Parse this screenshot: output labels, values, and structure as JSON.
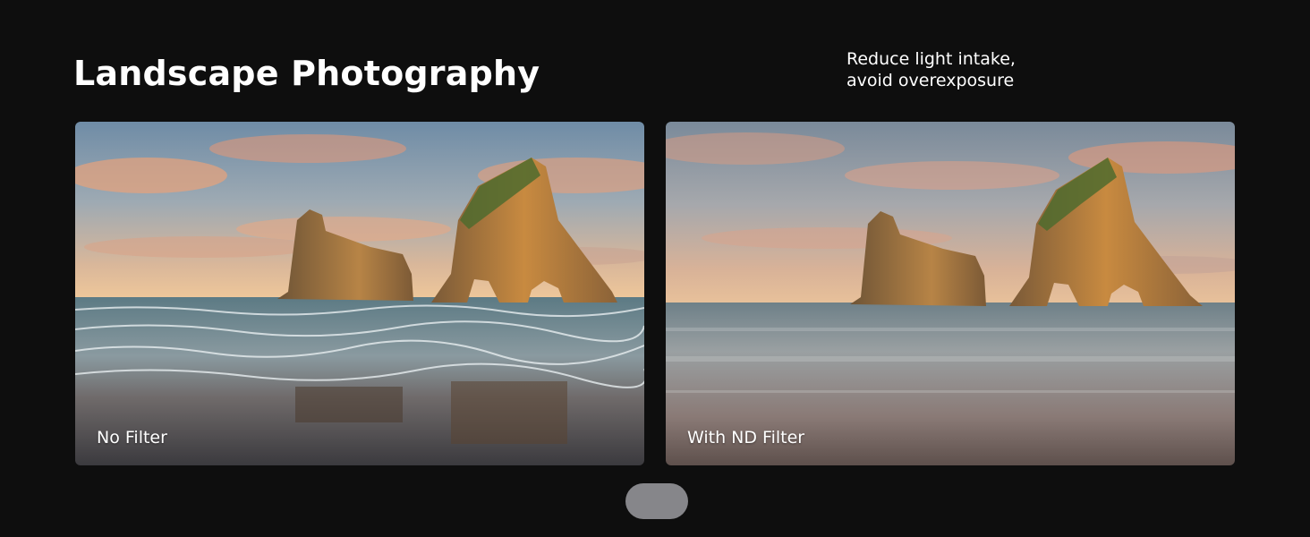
{
  "header": {
    "title": "Landscape Photography",
    "subtitle_lines": [
      "Reduce light intake,",
      "avoid overexposure"
    ]
  },
  "panels": [
    {
      "label": "No Filter"
    },
    {
      "label": "With ND Filter"
    }
  ],
  "pager": {
    "label": ""
  },
  "colors": {
    "background": "#0e0e0e",
    "text": "#ffffff",
    "pager": "#86868a"
  }
}
